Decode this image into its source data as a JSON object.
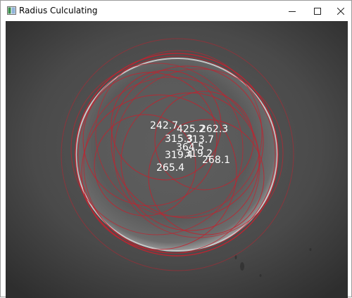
{
  "window": {
    "title": "Radius Culculating",
    "app_icon": "image-window-icon",
    "controls": {
      "minimize_icon": "minimize-icon",
      "maximize_icon": "maximize-icon",
      "close_icon": "close-icon"
    }
  },
  "image": {
    "circle_color": "#c0232f",
    "label_color": "#ffffff",
    "radius_labels": [
      "242.7",
      "425.2",
      "262.3",
      "315.3",
      "313.7",
      "364.5",
      "319.4",
      "319.2",
      "268.1",
      "265.4"
    ]
  }
}
